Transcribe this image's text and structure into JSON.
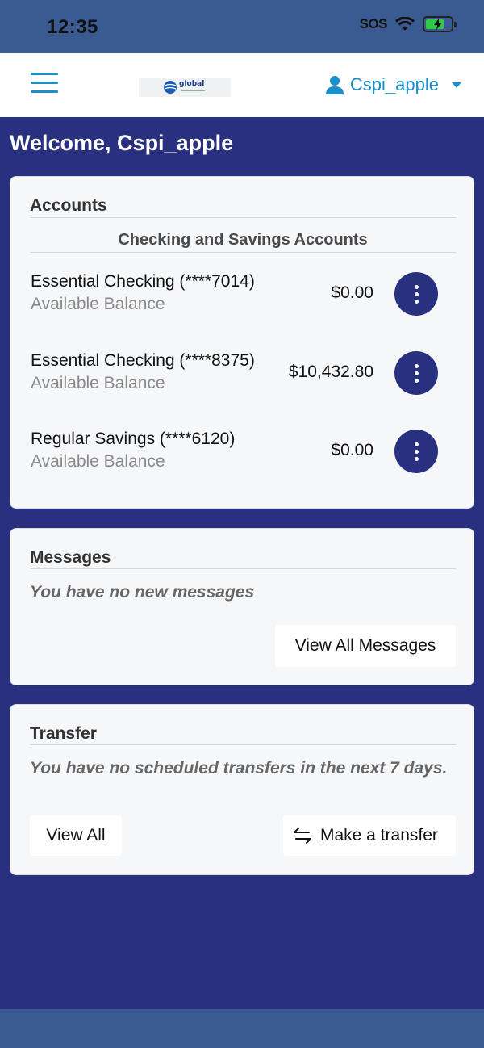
{
  "status": {
    "time": "12:35",
    "sos": "SOS"
  },
  "header": {
    "logo_text": "global",
    "user": "Cspi_apple"
  },
  "welcome": "Welcome, Cspi_apple",
  "accounts": {
    "title": "Accounts",
    "section": "Checking and Savings Accounts",
    "items": [
      {
        "name": "Essential Checking (****7014)",
        "sub": "Available Balance",
        "amount": "$0.00"
      },
      {
        "name": "Essential Checking (****8375)",
        "sub": "Available Balance",
        "amount": "$10,432.80"
      },
      {
        "name": "Regular Savings (****6120)",
        "sub": "Available Balance",
        "amount": "$0.00"
      }
    ]
  },
  "messages": {
    "title": "Messages",
    "note": "You have no new messages",
    "button": "View All Messages"
  },
  "transfer": {
    "title": "Transfer",
    "note": "You have no scheduled transfers in the next 7 days.",
    "view_all": "View All",
    "make": "Make a transfer"
  },
  "colors": {
    "brand": "#29307f",
    "accent": "#1a8fc9",
    "status_bar": "#3a5a92"
  }
}
